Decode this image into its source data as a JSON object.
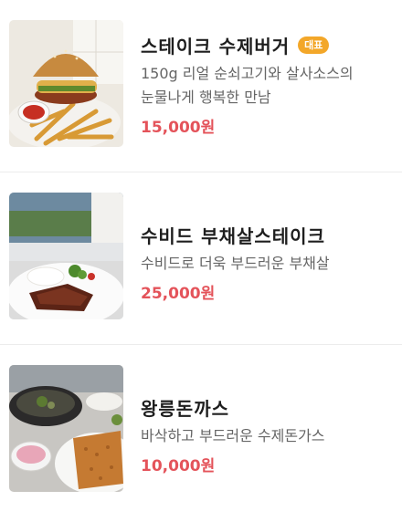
{
  "colors": {
    "accent_price": "#e4535a",
    "badge_bg": "#f3a729",
    "name_text": "#1e1e1e",
    "desc_text": "#666666",
    "divider": "#ececec"
  },
  "menu": {
    "items": [
      {
        "name": "스테이크 수제버거",
        "badge": "대표",
        "description": "150g 리얼 순쇠고기와 살사소스의 눈물나게 행복한 만남",
        "price": "15,000원",
        "image_icon": "burger-photo"
      },
      {
        "name": "수비드 부채살스테이크",
        "description": "수비드로 더욱 부드러운 부채살",
        "price": "25,000원",
        "image_icon": "steak-photo"
      },
      {
        "name": "왕릉돈까스",
        "description": "바삭하고 부드러운 수제돈가스",
        "price": "10,000원",
        "image_icon": "tonkatsu-photo"
      }
    ]
  }
}
